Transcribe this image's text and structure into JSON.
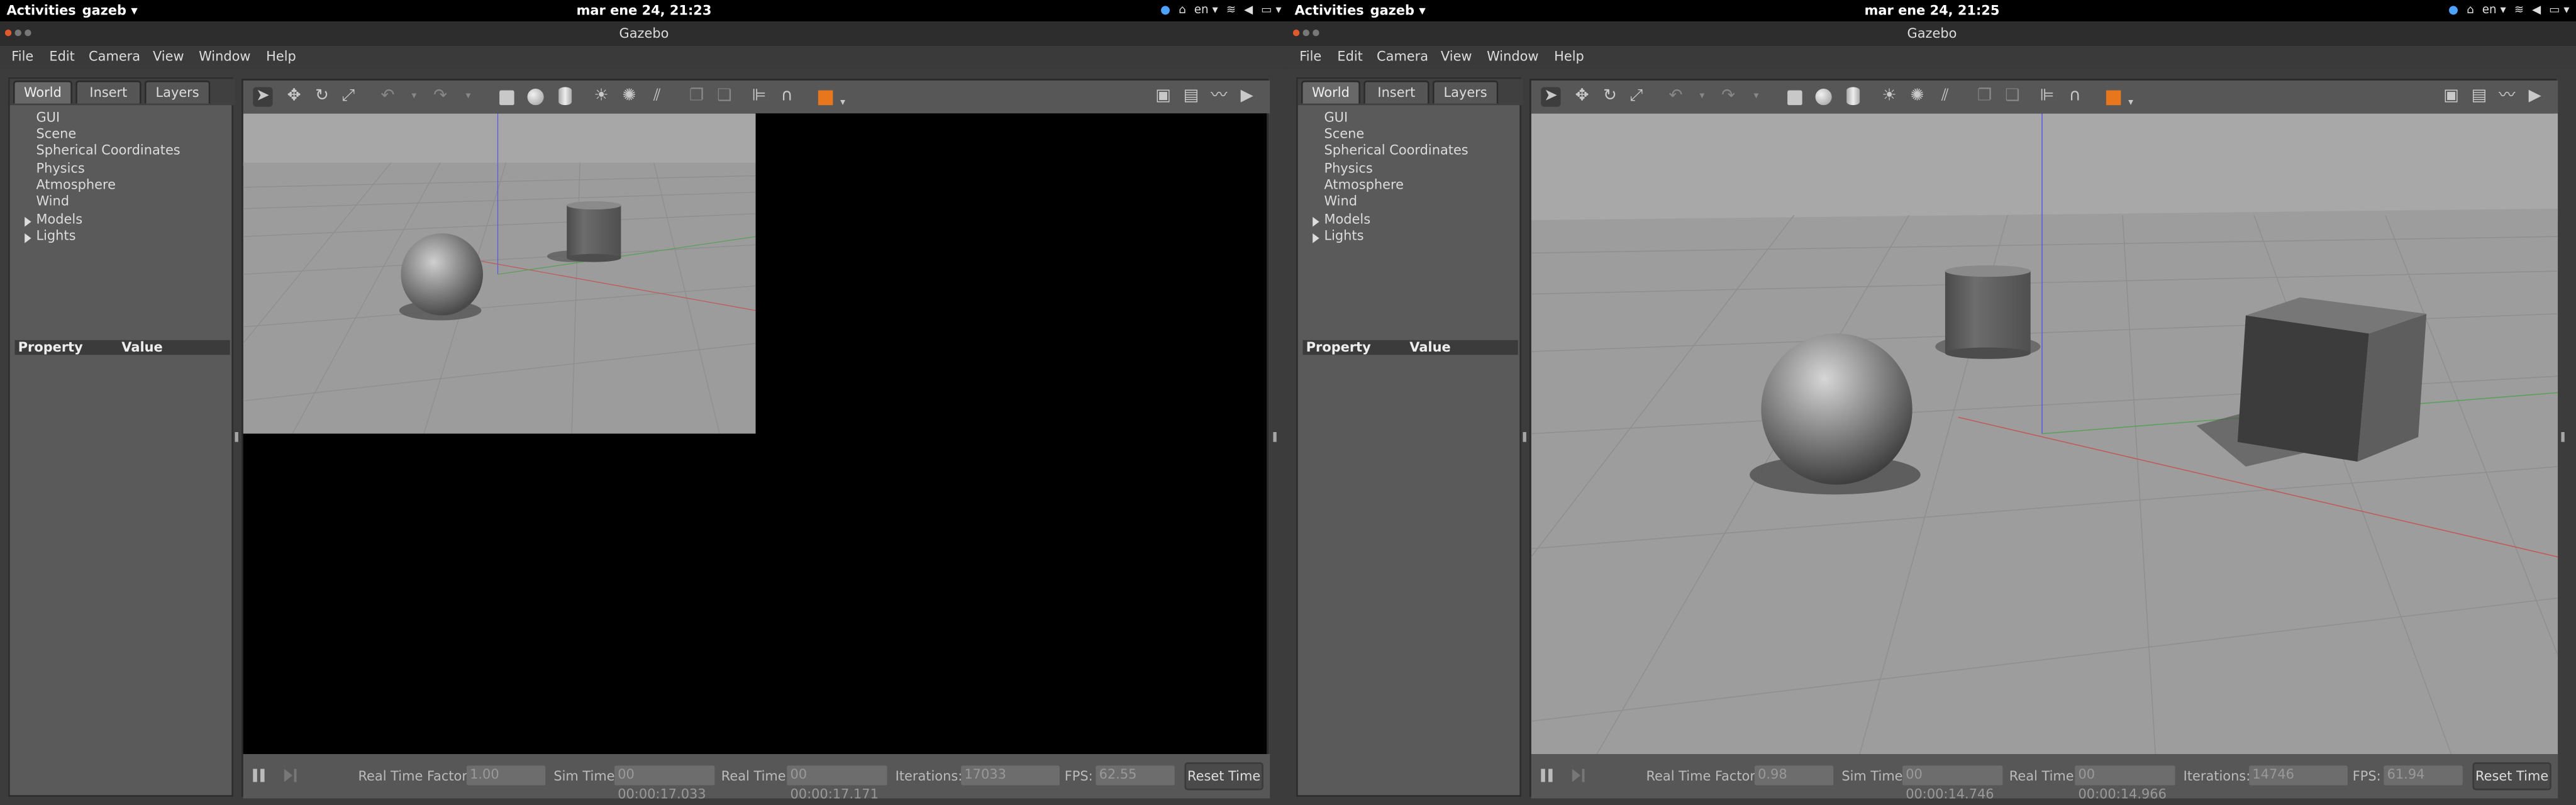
{
  "windows": [
    {
      "topbar": {
        "activities": "Activities",
        "app": "gazeb",
        "clock": "mar ene 24, 21:23",
        "lang": "en"
      },
      "title": "Gazebo",
      "menu": [
        "File",
        "Edit",
        "Camera",
        "View",
        "Window",
        "Help"
      ],
      "tabs": [
        "World",
        "Insert",
        "Layers"
      ],
      "tree": [
        "GUI",
        "Scene",
        "Spherical Coordinates",
        "Physics",
        "Atmosphere",
        "Wind",
        "Models",
        "Lights"
      ],
      "props": {
        "property": "Property",
        "value": "Value"
      },
      "status": {
        "rtf_label": "Real Time Factor:",
        "rtf": "1.00",
        "sim_label": "Sim Time:",
        "sim": "00 00:00:17.033",
        "real_label": "Real Time:",
        "real": "00 00:00:17.171",
        "iter_label": "Iterations:",
        "iter": "17033",
        "fps_label": "FPS:",
        "fps": "62.55",
        "reset": "Reset Time"
      }
    },
    {
      "topbar": {
        "activities": "Activities",
        "app": "gazeb",
        "clock": "mar ene 24, 21:25",
        "lang": "en"
      },
      "title": "Gazebo",
      "menu": [
        "File",
        "Edit",
        "Camera",
        "View",
        "Window",
        "Help"
      ],
      "tabs": [
        "World",
        "Insert",
        "Layers"
      ],
      "tree": [
        "GUI",
        "Scene",
        "Spherical Coordinates",
        "Physics",
        "Atmosphere",
        "Wind",
        "Models",
        "Lights"
      ],
      "props": {
        "property": "Property",
        "value": "Value"
      },
      "status": {
        "rtf_label": "Real Time Factor:",
        "rtf": "0.98",
        "sim_label": "Sim Time:",
        "sim": "00 00:00:14.746",
        "real_label": "Real Time:",
        "real": "00 00:00:14.966",
        "iter_label": "Iterations:",
        "iter": "14746",
        "fps_label": "FPS:",
        "fps": "61.94",
        "reset": "Reset Time"
      }
    }
  ],
  "colors": {
    "accent": "#e8761c",
    "toolbar": "#575757",
    "panel": "#5a5a5a"
  },
  "icons": [
    "select-arrow-icon",
    "translate-icon",
    "rotate-icon",
    "scale-icon",
    "undo-icon",
    "redo-icon",
    "box-icon",
    "sphere-icon",
    "cylinder-icon",
    "point-light-icon",
    "spot-light-icon",
    "directional-light-icon",
    "copy-icon",
    "paste-icon",
    "align-icon",
    "snap-icon",
    "view-angle-icon",
    "screenshot-icon",
    "log-icon",
    "plot-icon",
    "video-icon",
    "pause-icon",
    "step-icon"
  ]
}
